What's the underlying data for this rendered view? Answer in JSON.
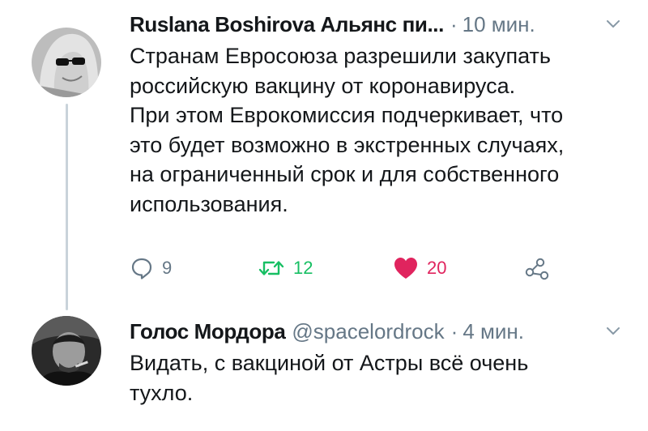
{
  "tweets": [
    {
      "author_name": "Ruslana Boshirova Альянс пи...",
      "handle": "",
      "separator": "·",
      "time": "10 мин.",
      "text_lines": [
        "Странам Евросоюза разрешили закупать",
        "российскую вакцину от коронавируса.",
        "При этом Еврокомиссия подчеркивает, что",
        "это будет возможно в экстренных случаях,",
        "на ограниченный срок и для собственного",
        "использования."
      ],
      "replies": "9",
      "retweets": "12",
      "likes": "20"
    },
    {
      "author_name": "Голос Мордора",
      "handle": "@spacelordrock",
      "separator": "·",
      "time": "4 мин.",
      "text_lines": [
        "Видать, с вакциной от Астры всё очень",
        "тухло."
      ]
    }
  ],
  "icons": {
    "reply": "reply-icon",
    "retweet": "retweet-icon",
    "like": "heart-icon",
    "share": "share-icon",
    "menu": "chevron-down-icon"
  },
  "colors": {
    "text": "#14171a",
    "secondary": "#657786",
    "retweet": "#17bf63",
    "like": "#e0245e",
    "thread_line": "#c9d3da"
  }
}
